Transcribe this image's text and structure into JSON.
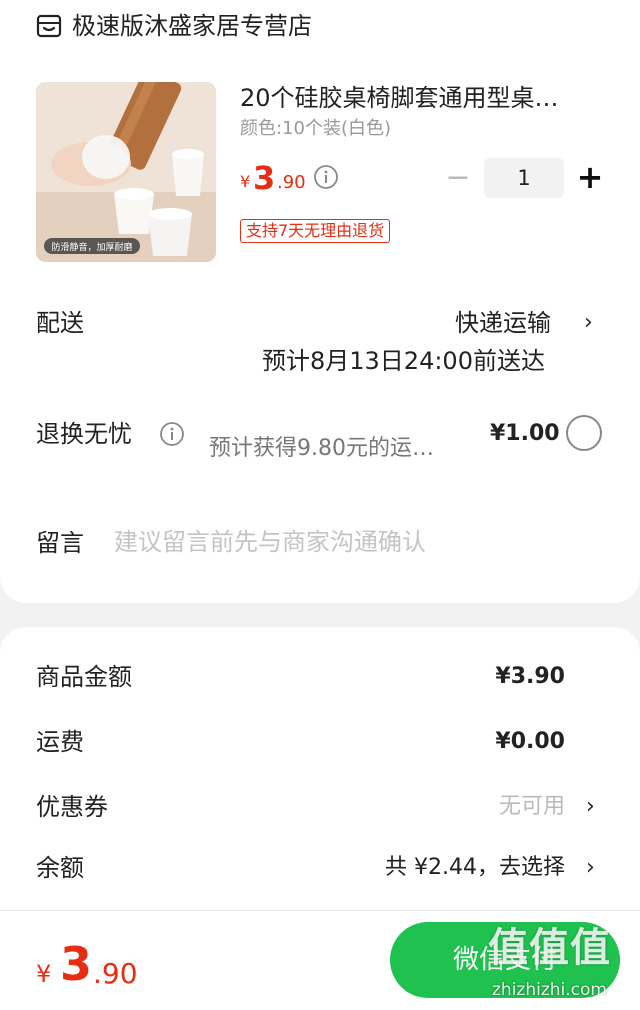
{
  "shop": {
    "icon": "shop-icon",
    "name": "极速版沐盛家居专营店"
  },
  "product": {
    "image_icon": "product-photo-silicone-covers",
    "image_caption": "防滑静音，加厚耐磨",
    "title": "20个硅胶桌椅脚套通用型桌…",
    "spec": "颜色:10个装(白色)",
    "price_yen": "¥",
    "price_int": "3",
    "price_dec": ".90",
    "quantity": "1",
    "minus": "−",
    "plus": "+",
    "return_badge": "支持7天无理由退货"
  },
  "delivery": {
    "label": "配送",
    "method": "快递运输",
    "chevron": "›",
    "eta": "预计8月13日24:00前送达"
  },
  "worry_free": {
    "label": "退换无忧",
    "desc": "预计获得9.80元的运…",
    "price": "¥1.00"
  },
  "memo": {
    "label": "留言",
    "placeholder": "建议留言前先与商家沟通确认"
  },
  "summary": {
    "goods_label": "商品金额",
    "goods_value": "¥3.90",
    "shipping_label": "运费",
    "shipping_value": "¥0.00",
    "coupon_label": "优惠券",
    "coupon_value": "无可用",
    "balance_label": "余额",
    "balance_value": "共 ¥2.44，去选择",
    "chevron": "›"
  },
  "footer": {
    "total_yen": "¥",
    "total_int": "3",
    "total_dec": ".90",
    "pay_label": "微信支付",
    "watermark": "值值值",
    "watermark_sub": "zhizhizhi.com"
  },
  "colors": {
    "price_red": "#e52e14",
    "pay_green": "#1fc14f"
  }
}
